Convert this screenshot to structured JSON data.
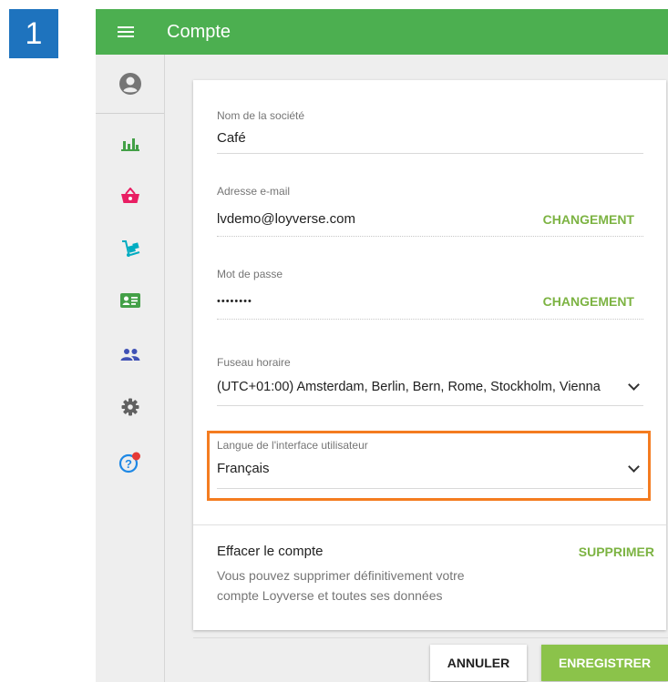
{
  "step_badge": "1",
  "appbar": {
    "title": "Compte"
  },
  "sidebar": {
    "items": [
      {
        "icon": "account-circle-icon"
      },
      {
        "icon": "bar-chart-icon",
        "color": "#43a047"
      },
      {
        "icon": "shopping-basket-icon",
        "color": "#e91e63"
      },
      {
        "icon": "dolly-icon",
        "color": "#00acc1"
      },
      {
        "icon": "id-card-icon",
        "color": "#43a047"
      },
      {
        "icon": "people-icon",
        "color": "#3f51b5"
      },
      {
        "icon": "gear-icon",
        "color": "#616161"
      },
      {
        "icon": "help-icon",
        "color": "#1e88e5",
        "badge_color": "#e53935"
      }
    ]
  },
  "form": {
    "company": {
      "label": "Nom de la société",
      "value": "Café"
    },
    "email": {
      "label": "Adresse e-mail",
      "value": "lvdemo@loyverse.com",
      "action": "CHANGEMENT"
    },
    "password": {
      "label": "Mot de passe",
      "value": "••••••••",
      "action": "CHANGEMENT"
    },
    "timezone": {
      "label": "Fuseau horaire",
      "value": "(UTC+01:00) Amsterdam, Berlin, Bern, Rome, Stockholm, Vienna"
    },
    "language": {
      "label": "Langue de l'interface utilisateur",
      "value": "Français"
    },
    "delete": {
      "title": "Effacer le compte",
      "description_line1": "Vous pouvez supprimer définitivement votre",
      "description_line2": "compte Loyverse et toutes ses données",
      "action": "SUPPRIMER"
    }
  },
  "buttons": {
    "cancel": "ANNULER",
    "save": "ENREGISTRER"
  },
  "colors": {
    "appbar": "#4caf50",
    "accent_link": "#7cb342",
    "save_button": "#8bc34a",
    "highlight": "#f47c20",
    "step_badge": "#1e73be"
  }
}
